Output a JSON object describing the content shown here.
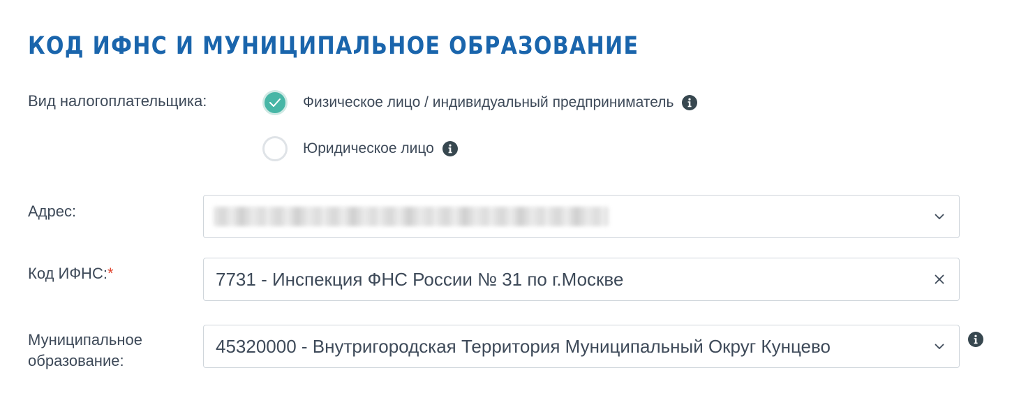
{
  "header": {
    "title": "КОД ИФНС И МУНИЦИПАЛЬНОЕ ОБРАЗОВАНИЕ"
  },
  "taxpayer_type": {
    "label": "Вид налогоплательщика:",
    "options": [
      {
        "label": "Физическое лицо / индивидуальный предприниматель",
        "checked": true
      },
      {
        "label": "Юридическое лицо",
        "checked": false
      }
    ]
  },
  "address": {
    "label": "Адрес:",
    "value_redacted": true
  },
  "ifns_code": {
    "label": "Код ИФНС:",
    "required_mark": "*",
    "value": "7731 - Инспекция ФНС России № 31 по г.Москве"
  },
  "municipality": {
    "label_line1": "Муниципальное",
    "label_line2": "образование:",
    "value": "45320000 - Внутригородская Территория Муниципальный Округ Кунцево"
  },
  "colors": {
    "title": "#1a65ac",
    "radio_checked": "#47b6a6",
    "text": "#3e4a59",
    "required": "#e0402a",
    "icon": "#37474f"
  },
  "icons": {
    "radio_checked": "check-icon",
    "info": "info-icon",
    "dropdown": "chevron-down-icon",
    "clear": "close-icon"
  }
}
